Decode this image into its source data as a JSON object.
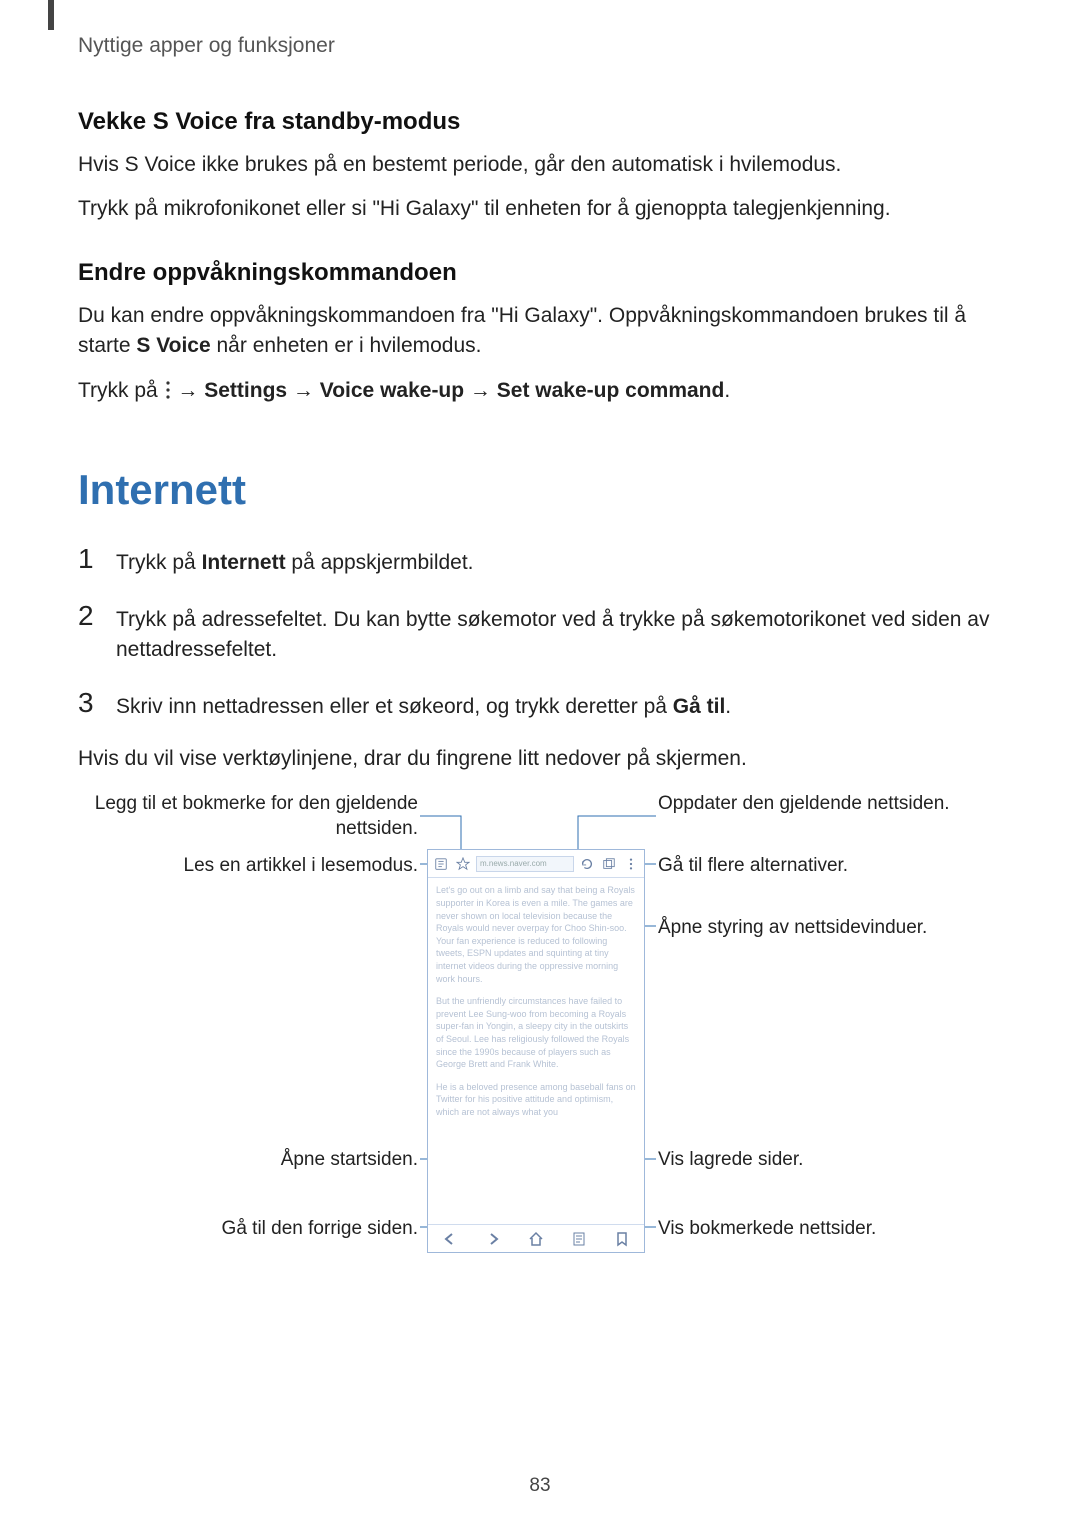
{
  "header": "Nyttige apper og funksjoner",
  "sec1": {
    "title": "Vekke S Voice fra standby-modus",
    "p1": "Hvis S Voice ikke brukes på en bestemt periode, går den automatisk i hvilemodus.",
    "p2": "Trykk på mikrofonikonet eller si \"Hi Galaxy\" til enheten for å gjenoppta talegjenkjenning."
  },
  "sec2": {
    "title": "Endre oppvåkningskommandoen",
    "p1_a": "Du kan endre oppvåkningskommandoen fra \"Hi Galaxy\". Oppvåkningskommandoen brukes til å starte ",
    "p1_strong": "S Voice",
    "p1_b": " når enheten er i hvilemodus.",
    "p2_a": "Trykk på ",
    "p2_arrow": " → ",
    "p2_s1": "Settings",
    "p2_s2": "Voice wake-up",
    "p2_s3": "Set wake-up command",
    "p2_end": "."
  },
  "internet": {
    "title": "Internett",
    "step1_a": "Trykk på ",
    "step1_strong": "Internett",
    "step1_b": " på appskjermbildet.",
    "step2": "Trykk på adressefeltet. Du kan bytte søkemotor ved å trykke på søkemotorikonet ved siden av nettadressefeltet.",
    "step3_a": "Skriv inn nettadressen eller et søkeord, og trykk deretter på ",
    "step3_strong": "Gå til",
    "step3_b": ".",
    "p_after": "Hvis du vil vise verktøylinjene, drar du fingrene litt nedover på skjermen."
  },
  "callouts": {
    "left": {
      "bookmark_add": "Legg til et bokmerke for den gjeldende nettsiden.",
      "reader": "Les en artikkel i lesemodus.",
      "home": "Åpne startsiden.",
      "back": "Gå til den forrige siden."
    },
    "right": {
      "refresh": "Oppdater den gjeldende nettsiden.",
      "more": "Gå til flere alternativer.",
      "windows": "Åpne styring av nettsidevinduer.",
      "saved": "Vis lagrede sider.",
      "bookmarks": "Vis bokmerkede nettsider."
    }
  },
  "phone_placeholder": {
    "addr": "m.news.naver.com",
    "para1": "Let's go out on a limb and say that being a Royals supporter in Korea is even a mile. The games are never shown on local television because the Royals would never overpay for Choo Shin-soo. Your fan experience is reduced to following tweets, ESPN updates and squinting at tiny internet videos during the oppressive morning work hours.",
    "para2": "But the unfriendly circumstances have failed to prevent Lee Sung-woo from becoming a Royals super-fan in Yongin, a sleepy city in the outskirts of Seoul. Lee has religiously followed the Royals since the 1990s because of players such as George Brett and Frank White.",
    "para3": "He is a beloved presence among baseball fans on Twitter for his positive attitude and optimism, which are not always what you"
  },
  "page_number": "83"
}
